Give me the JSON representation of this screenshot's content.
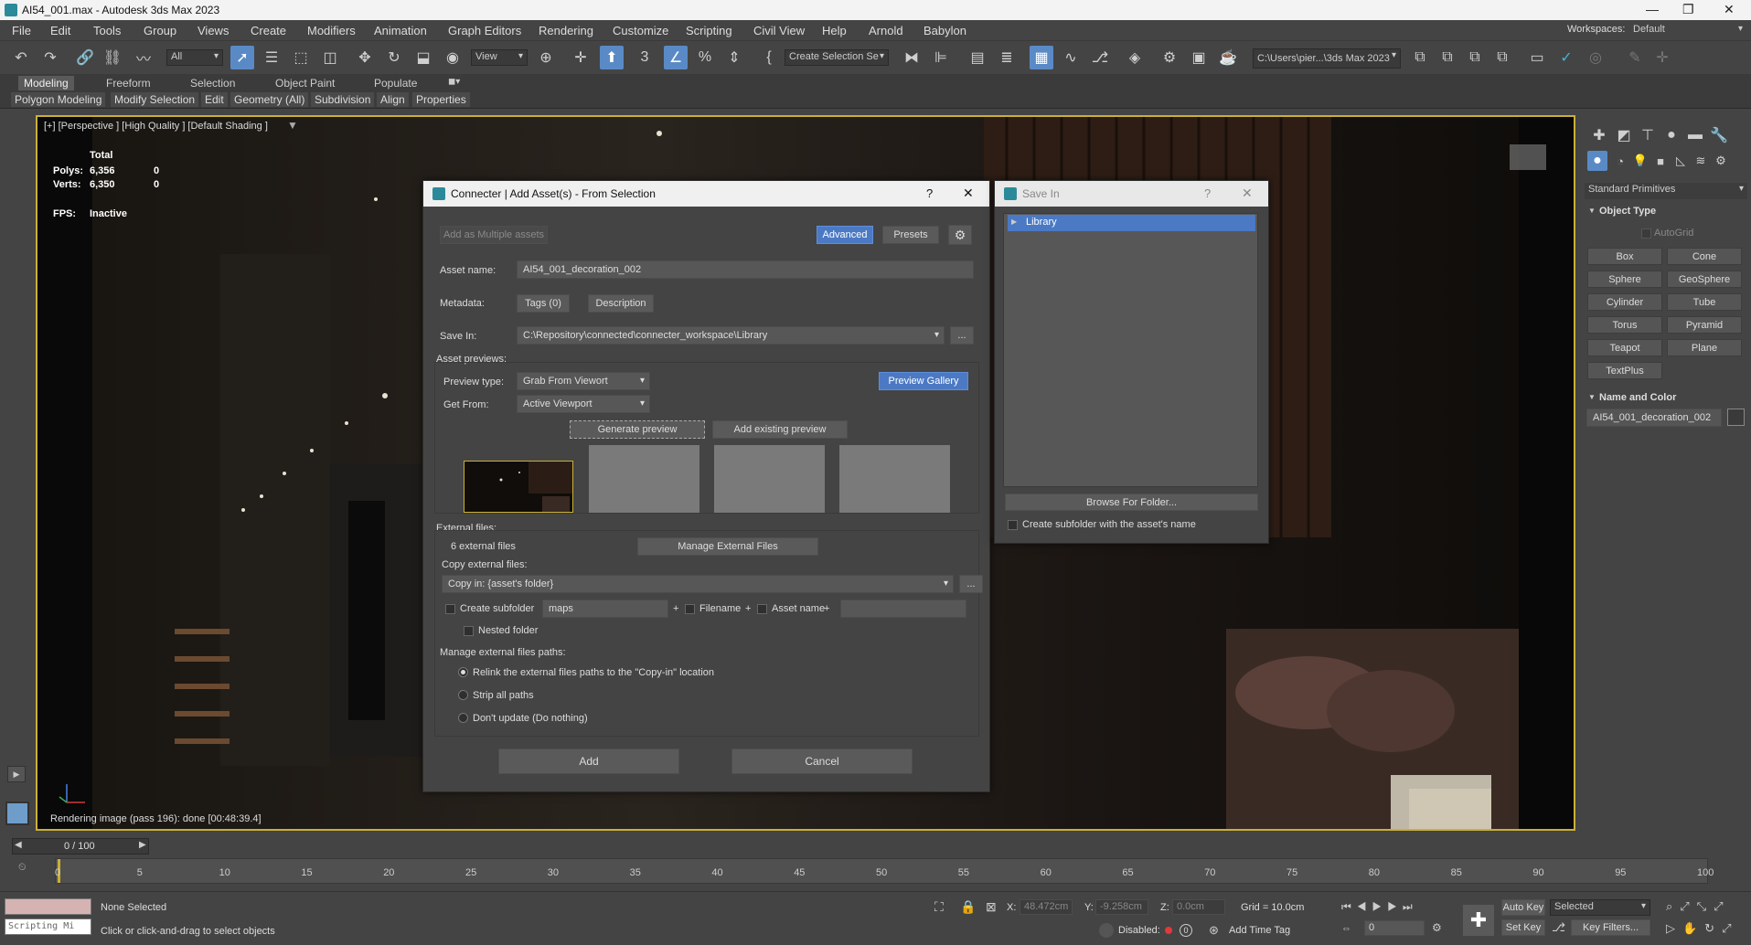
{
  "window": {
    "title": "AI54_001.max - Autodesk 3ds Max 2023",
    "minimize": "—",
    "maximize": "❐",
    "close": "✕"
  },
  "menu": [
    "File",
    "Edit",
    "Tools",
    "Group",
    "Views",
    "Create",
    "Modifiers",
    "Animation",
    "Graph Editors",
    "Rendering",
    "Customize",
    "Scripting",
    "Civil View",
    "Help",
    "Arnold",
    "Babylon"
  ],
  "workspace": {
    "label": "Workspaces:",
    "value": "Default"
  },
  "toolbar": {
    "filter": "All",
    "ref_coord": "View",
    "selection_set": "Create Selection Se",
    "project_path": "C:\\Users\\pier...\\3ds Max 2023"
  },
  "ribbon": {
    "tabs": [
      "Modeling",
      "Freeform",
      "Selection",
      "Object Paint",
      "Populate"
    ],
    "subtabs": [
      "Polygon Modeling",
      "Modify Selection",
      "Edit",
      "Geometry (All)",
      "Subdivision",
      "Align",
      "Properties"
    ]
  },
  "viewport": {
    "label": "[+] [Perspective ] [High Quality ] [Default Shading ]",
    "stats_total": "Total",
    "polys_label": "Polys:",
    "polys_value": "6,356",
    "polys_sel": "0",
    "verts_label": "Verts:",
    "verts_value": "6,350",
    "verts_sel": "0",
    "fps_label": "FPS:",
    "fps_value": "Inactive",
    "render_status": "Rendering image (pass 196): done [00:48:39.4]"
  },
  "dialog": {
    "title": "Connecter | Add Asset(s) - From Selection",
    "help": "?",
    "close": "✕",
    "add_multiple": "Add as Multiple assets",
    "advanced": "Advanced",
    "presets": "Presets",
    "asset_name_label": "Asset name:",
    "asset_name_value": "AI54_001_decoration_002",
    "metadata_label": "Metadata:",
    "tags": "Tags (0)",
    "description": "Description",
    "save_in_label": "Save In:",
    "save_in_value": "C:\\Repository\\connected\\connecter_workspace\\Library",
    "browse": "...",
    "previews_label": "Asset previews:",
    "preview_type_label": "Preview type:",
    "preview_type_value": "Grab From Viewort",
    "get_from_label": "Get From:",
    "get_from_value": "Active Viewport",
    "preview_gallery": "Preview Gallery",
    "generate_preview": "Generate preview",
    "add_existing_preview": "Add existing preview",
    "external_files_label": "External files:",
    "external_files_count": "6 external files",
    "manage_external": "Manage External Files",
    "copy_external_label": "Copy external files:",
    "copy_in_value": "Copy in: {asset's folder}",
    "create_subfolder": "Create subfolder",
    "subfolder_value": "maps",
    "plus": "+",
    "filename": "Filename",
    "asset_name_opt": "Asset name",
    "nested_folder": "Nested folder",
    "manage_paths_label": "Manage external files paths:",
    "radio_relink": "Relink the external files paths to the \"Copy-in\" location",
    "radio_strip": "Strip all paths",
    "radio_dont": "Don't update (Do nothing)",
    "add": "Add",
    "cancel": "Cancel"
  },
  "save_in_dialog": {
    "title": "Save In",
    "help": "?",
    "close": "✕",
    "tree_item": "Library",
    "browse_folder": "Browse For Folder...",
    "create_subfolder": "Create subfolder with the asset's name"
  },
  "command_panel": {
    "category": "Standard Primitives",
    "object_type": "Object Type",
    "autogrid": "AutoGrid",
    "buttons": [
      "Box",
      "Cone",
      "Sphere",
      "GeoSphere",
      "Cylinder",
      "Tube",
      "Torus",
      "Pyramid",
      "Teapot",
      "Plane",
      "TextPlus"
    ],
    "name_and_color": "Name and Color",
    "object_name": "AI54_001_decoration_002"
  },
  "timeline": {
    "frame": "0 / 100",
    "ticks": [
      "0",
      "5",
      "10",
      "15",
      "20",
      "25",
      "30",
      "35",
      "40",
      "45",
      "50",
      "55",
      "60",
      "65",
      "70",
      "75",
      "80",
      "85",
      "90",
      "95",
      "100"
    ]
  },
  "status": {
    "script_box": "Scripting Mi",
    "selection": "None Selected",
    "prompt": "Click or click-and-drag to select objects",
    "x_label": "X:",
    "x_value": "48.472cm",
    "y_label": "Y:",
    "y_value": "-9.258cm",
    "z_label": "Z:",
    "z_value": "0.0cm",
    "grid": "Grid = 10.0cm",
    "disabled": "Disabled:",
    "add_time_tag": "Add Time Tag",
    "auto_key": "Auto Key",
    "set_key": "Set Key",
    "selected": "Selected",
    "key_filters": "Key Filters...",
    "frame_value": "0"
  },
  "colors": {
    "accent": "#4b79c4",
    "viewport_border": "#c9b037",
    "selected_item": "#4b79c4"
  }
}
